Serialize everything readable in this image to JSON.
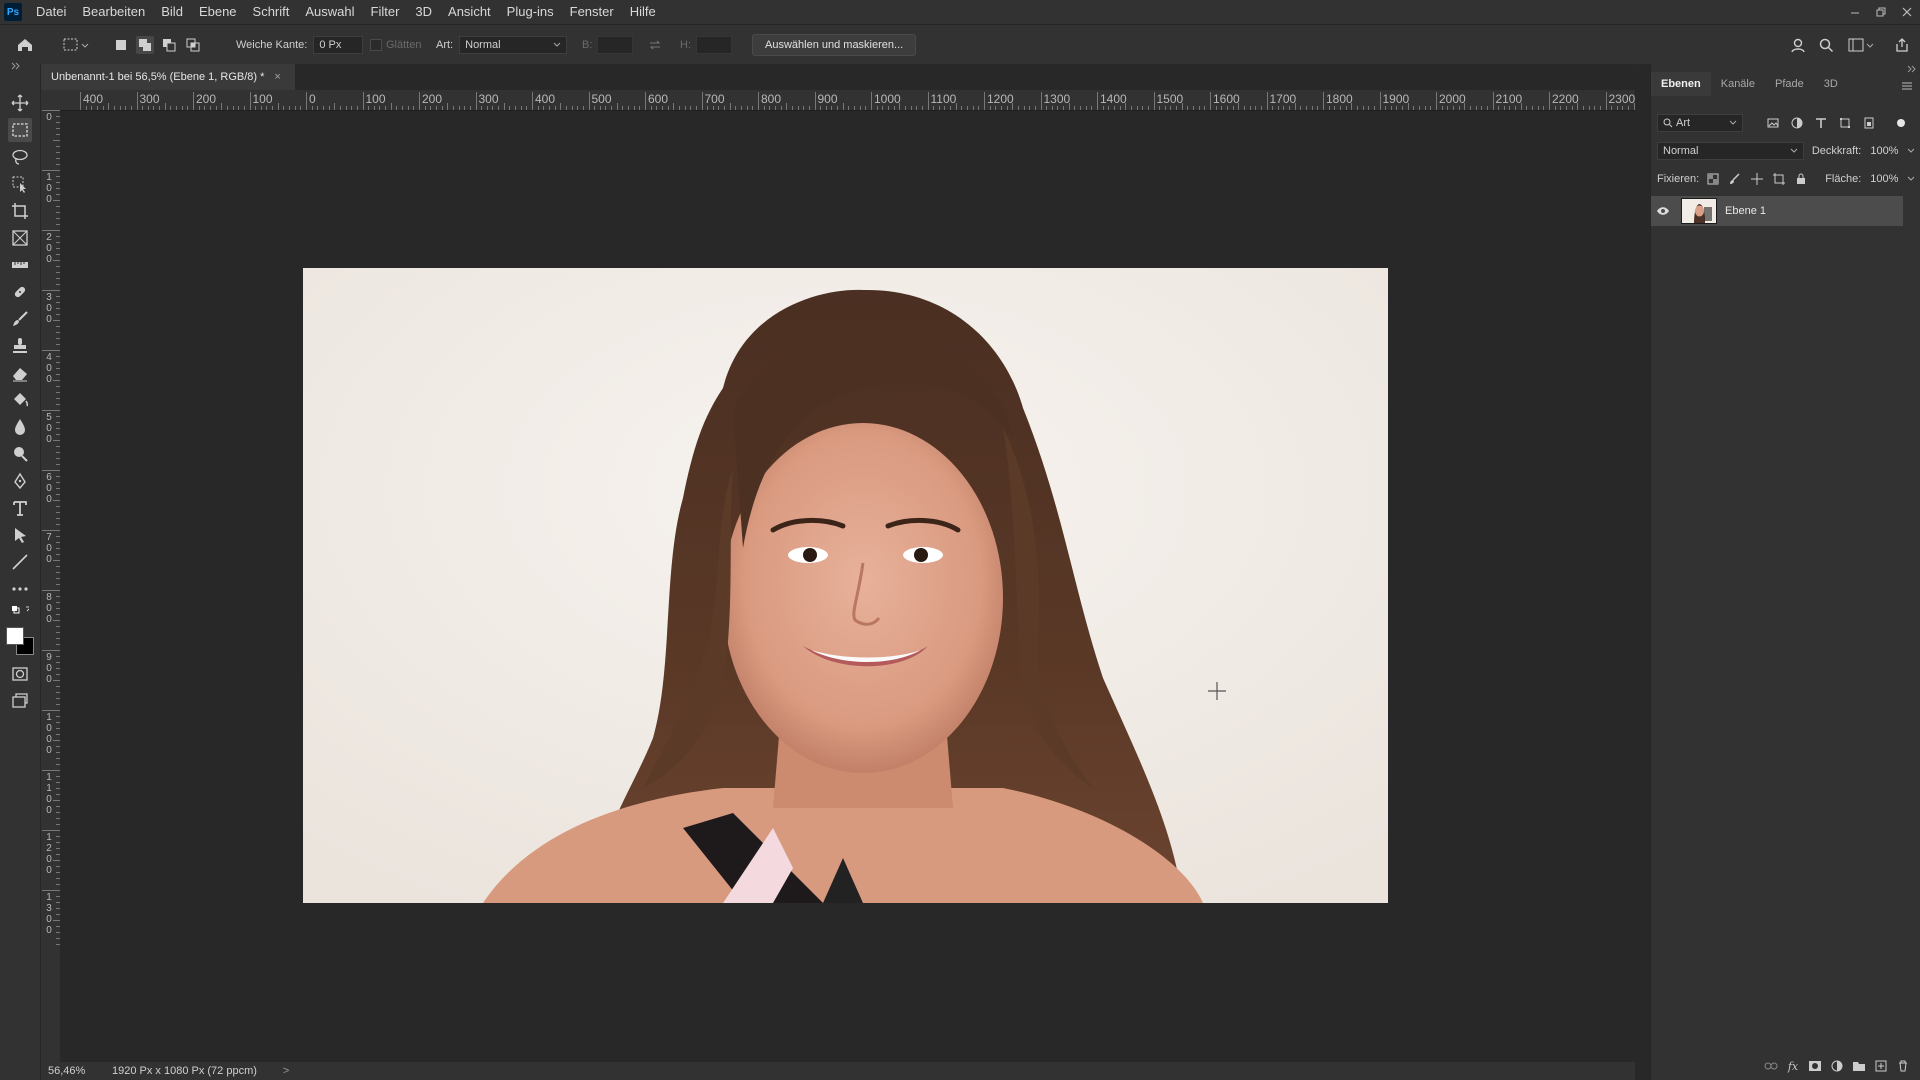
{
  "menubar": {
    "app_icon": "Ps",
    "items": [
      "Datei",
      "Bearbeiten",
      "Bild",
      "Ebene",
      "Schrift",
      "Auswahl",
      "Filter",
      "3D",
      "Ansicht",
      "Plug-ins",
      "Fenster",
      "Hilfe"
    ]
  },
  "options": {
    "feather_label": "Weiche Kante:",
    "feather_value": "0 Px",
    "antialias_label": "Glätten",
    "style_label": "Art:",
    "style_value": "Normal",
    "width_label": "B:",
    "height_label": "H:",
    "select_mask_button": "Auswählen und maskieren..."
  },
  "document": {
    "tab_title": "Unbenannt-1 bei 56,5% (Ebene 1, RGB/8) *",
    "close_glyph": "×"
  },
  "ruler": {
    "top_labels": [
      "400",
      "300",
      "200",
      "100",
      "0",
      "100",
      "200",
      "300",
      "400",
      "500",
      "600",
      "700",
      "800",
      "900",
      "1000",
      "1100",
      "1200",
      "1300",
      "1400",
      "1500",
      "1600",
      "1700",
      "1800",
      "1900",
      "2000",
      "2100",
      "2200",
      "2300"
    ],
    "left_labels": [
      "0",
      "100",
      "200",
      "300",
      "400",
      "500",
      "600",
      "700",
      "800",
      "900",
      "1000",
      "1100",
      "1200",
      "1300"
    ]
  },
  "status": {
    "zoom": "56,46%",
    "doc_info": "1920 Px x 1080 Px (72 ppcm)",
    "arrow": ">"
  },
  "panel": {
    "tabs": [
      "Ebenen",
      "Kanäle",
      "Pfade",
      "3D"
    ],
    "filter_label": "Art",
    "blend_mode": "Normal",
    "opacity_label": "Deckkraft:",
    "opacity_value": "100%",
    "lock_label": "Fixieren:",
    "fill_label": "Fläche:",
    "fill_value": "100%",
    "layers": [
      {
        "name": "Ebene 1",
        "visible": true
      }
    ]
  },
  "colors": {
    "foreground": "#ffffff",
    "background": "#000000",
    "accent": "#31a8ff"
  }
}
